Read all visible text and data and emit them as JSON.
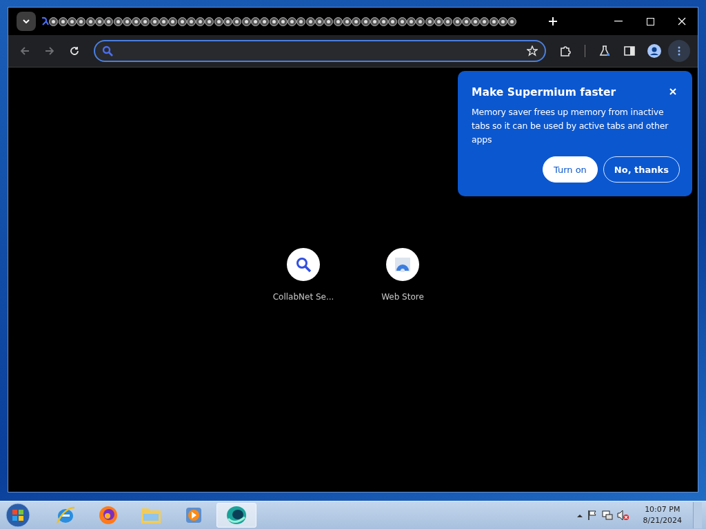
{
  "tabs": [
    {
      "selected": true
    },
    {
      "selected": false
    },
    {
      "selected": false
    },
    {
      "selected": false
    },
    {
      "selected": false
    },
    {
      "selected": false
    },
    {
      "selected": false
    },
    {
      "selected": false
    },
    {
      "selected": false
    },
    {
      "selected": false
    },
    {
      "selected": false
    },
    {
      "selected": false
    },
    {
      "selected": false
    },
    {
      "selected": false
    },
    {
      "selected": false
    },
    {
      "selected": false
    },
    {
      "selected": false
    },
    {
      "selected": false
    },
    {
      "selected": false
    },
    {
      "selected": false
    },
    {
      "selected": false
    },
    {
      "selected": false
    },
    {
      "selected": false
    },
    {
      "selected": false
    },
    {
      "selected": false
    },
    {
      "selected": false
    },
    {
      "selected": false
    },
    {
      "selected": false
    },
    {
      "selected": false
    },
    {
      "selected": false
    },
    {
      "selected": false
    },
    {
      "selected": false
    },
    {
      "selected": false
    },
    {
      "selected": false
    },
    {
      "selected": false
    },
    {
      "selected": false
    },
    {
      "selected": false
    },
    {
      "selected": false
    },
    {
      "selected": false
    },
    {
      "selected": false
    },
    {
      "selected": false
    },
    {
      "selected": false
    },
    {
      "selected": false
    },
    {
      "selected": false
    },
    {
      "selected": false
    },
    {
      "selected": false
    },
    {
      "selected": false
    },
    {
      "selected": false
    },
    {
      "selected": false
    },
    {
      "selected": false
    },
    {
      "selected": false
    },
    {
      "selected": false
    }
  ],
  "toolbar": {
    "back_disabled": true,
    "forward_disabled": true
  },
  "shortcuts": [
    {
      "kind": "search",
      "label": "CollabNet Se..."
    },
    {
      "kind": "store",
      "label": "Web Store"
    }
  ],
  "popup": {
    "title": "Make Supermium faster",
    "body": "Memory saver frees up memory from inactive tabs so it can be used by active tabs and other apps",
    "buttons": [
      {
        "label": "Turn on",
        "kind": "primary"
      },
      {
        "label": "No, thanks",
        "kind": "outline"
      }
    ]
  },
  "taskbar": {
    "apps": [
      {
        "kind": "ie",
        "selected": false
      },
      {
        "kind": "firefox",
        "selected": false
      },
      {
        "kind": "folder",
        "selected": false
      },
      {
        "kind": "media",
        "selected": false
      },
      {
        "kind": "browser",
        "selected": true
      }
    ],
    "time": "10:07 PM",
    "date": "8/21/2024"
  }
}
